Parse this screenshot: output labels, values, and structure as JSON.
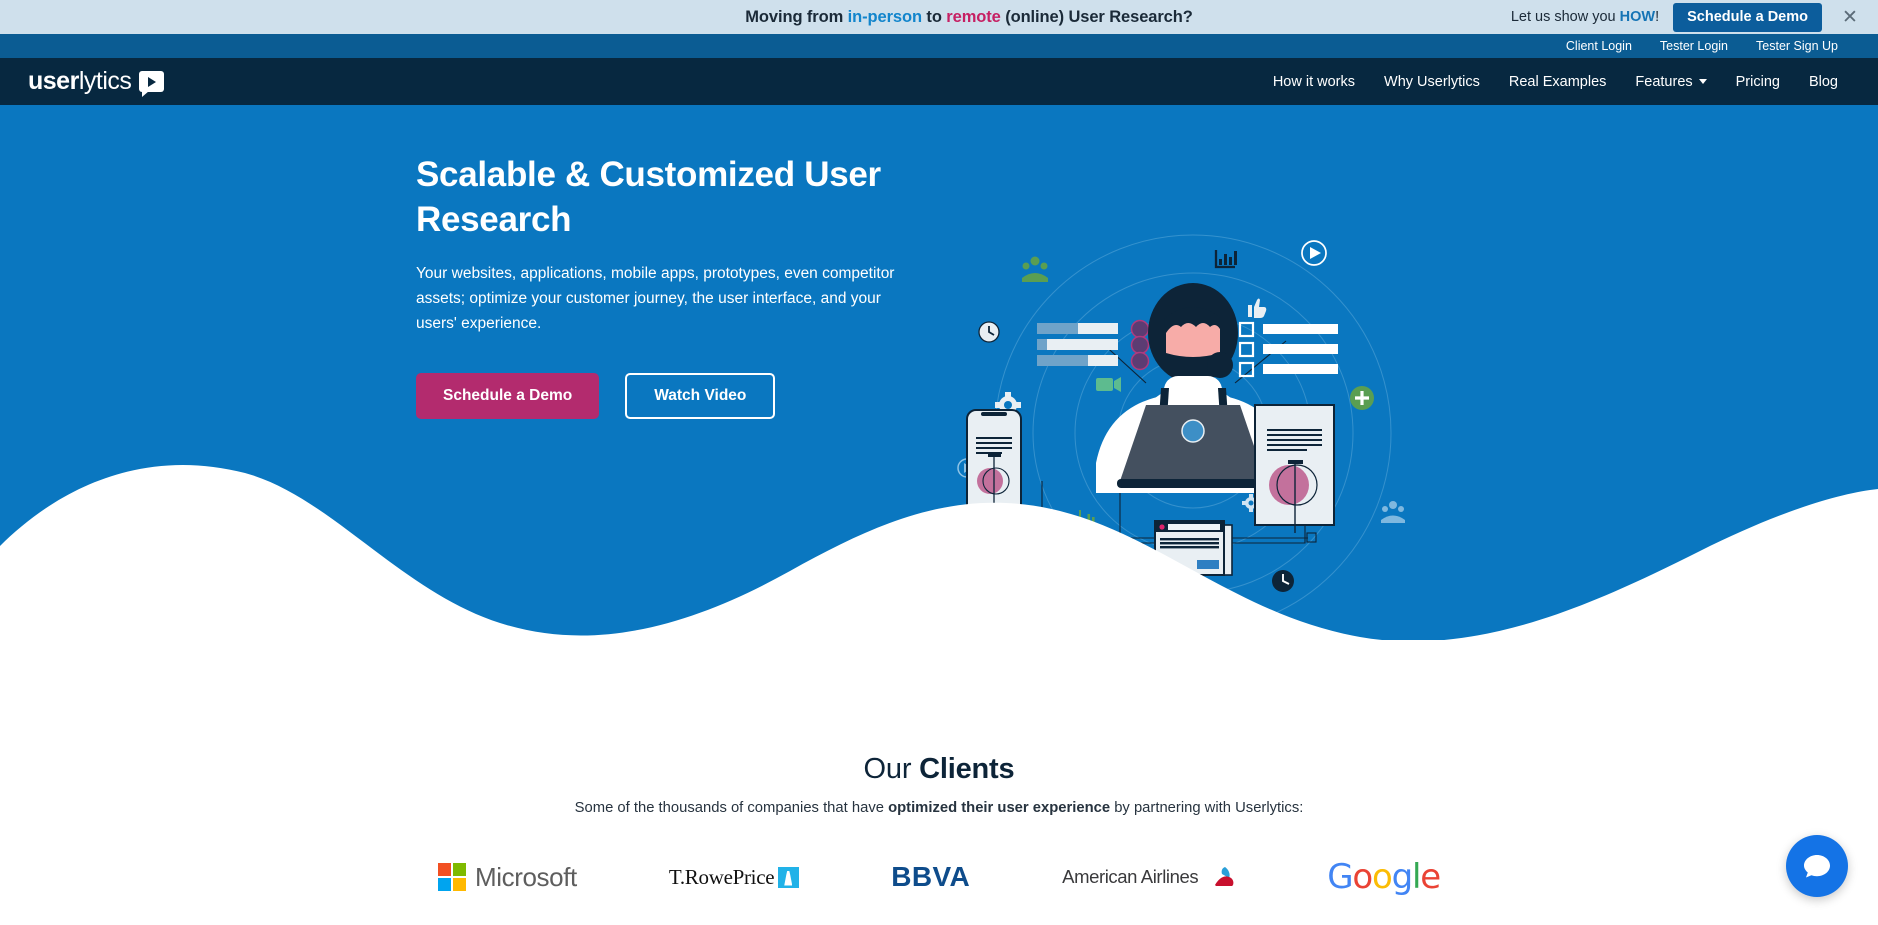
{
  "promo": {
    "text_1": "Moving from ",
    "hl_blue": "in-person",
    "text_2": " to ",
    "hl_pink": "remote",
    "text_3": " (online) User Research?",
    "cta_prefix": "Let us show you ",
    "cta_how": "HOW",
    "cta_suffix": "!",
    "button": "Schedule a Demo",
    "close_icon": "close-icon",
    "close_glyph": "✕"
  },
  "utility": {
    "links": [
      {
        "label": "Client Login"
      },
      {
        "label": "Tester Login"
      },
      {
        "label": "Tester Sign Up"
      }
    ]
  },
  "nav": {
    "logo_bold": "user",
    "logo_light": "lytics",
    "logo_icon": "play-button-icon",
    "links": [
      {
        "label": "How it works",
        "caret": false
      },
      {
        "label": "Why Userlytics",
        "caret": false
      },
      {
        "label": "Real Examples",
        "caret": false
      },
      {
        "label": "Features",
        "caret": true
      },
      {
        "label": "Pricing",
        "caret": false
      },
      {
        "label": "Blog",
        "caret": false
      }
    ]
  },
  "hero": {
    "title": "Scalable & Customized User Research",
    "subtitle": "Your websites, applications, mobile apps, prototypes, even competitor assets; optimize your customer journey, the user interface, and your users' experience.",
    "primary_button": "Schedule a Demo",
    "secondary_button": "Watch Video",
    "illustration_name": "user-research-illustration"
  },
  "clients": {
    "title_light": "Our ",
    "title_bold": "Clients",
    "sub_before": "Some of the thousands of companies that have ",
    "sub_bold": "optimized their user experience",
    "sub_after": " by partnering with Userlytics:",
    "logos": [
      {
        "name": "microsoft-logo",
        "label": "Microsoft"
      },
      {
        "name": "trowe-price-logo",
        "label": "T.RowePrice"
      },
      {
        "name": "bbva-logo",
        "label": "BBVA"
      },
      {
        "name": "american-airlines-logo",
        "label": "American Airlines"
      },
      {
        "name": "google-logo",
        "label": "Google"
      }
    ]
  },
  "chat": {
    "icon": "chat-bubble-icon",
    "aria": "Open chat"
  },
  "colors": {
    "promo_bg": "#cfe0ec",
    "utility_bg": "#0b5c93",
    "nav_bg": "#072840",
    "hero_bg": "#0a77c0",
    "accent_pink": "#b32b6e",
    "promo_btn": "#0c5d9c",
    "chat_blue": "#1473e6",
    "dark_text": "#0d2438"
  }
}
